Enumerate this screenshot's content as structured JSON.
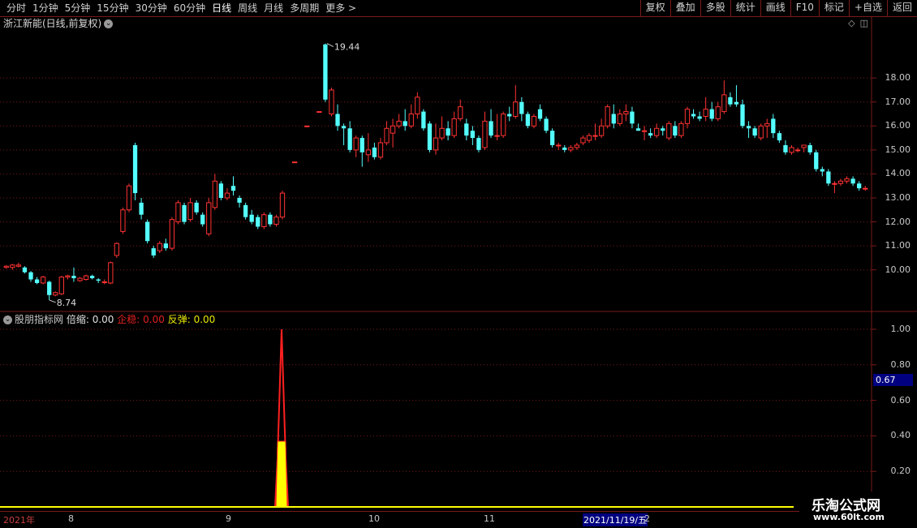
{
  "toolbar": {
    "tabs": [
      "分时",
      "1分钟",
      "5分钟",
      "15分钟",
      "30分钟",
      "60分钟",
      "日线",
      "周线",
      "月线",
      "多周期",
      "更多 >"
    ],
    "right_buttons": [
      "复权",
      "叠加",
      "多股",
      "统计",
      "画线",
      "F10",
      "标记",
      "+自选",
      "返回"
    ]
  },
  "stock": {
    "title": "浙江新能(日线,前复权)"
  },
  "indicator": {
    "name": "股朋指标网",
    "label1": "倍缩:",
    "value1": "0.00",
    "label2": "企稳:",
    "value2": "0.00",
    "label3": "反弹:",
    "value3": "0.00",
    "price_tag": "0.67"
  },
  "price_axis": [
    "18.00",
    "17.00",
    "16.00",
    "15.00",
    "14.00",
    "13.00",
    "12.00",
    "11.00",
    "10.00"
  ],
  "ind_axis": [
    "1.00",
    "0.80",
    "0.60",
    "0.40",
    "0.20"
  ],
  "annotations": {
    "high": "19.44",
    "low": "8.74"
  },
  "dates": {
    "year": "2021年",
    "m8": "8",
    "m9": "9",
    "m10": "10",
    "m11": "11",
    "selected": "2021/11/19/五",
    "m12": "2"
  },
  "watermark": {
    "line1": "乐淘公式网",
    "line2": "www.60lt.com"
  },
  "colors": {
    "up": "#ff3232",
    "down": "#54ffff",
    "grid": "#7a1a1a",
    "yellow": "#ffff00"
  },
  "chart_data": {
    "type": "candlestick",
    "candles": [
      [
        10.1,
        10.15,
        10.05,
        10.2
      ],
      [
        10.1,
        10.2,
        10.0,
        10.25
      ],
      [
        10.15,
        10.2,
        10.1,
        10.3
      ],
      [
        10.1,
        9.9,
        9.85,
        10.15
      ],
      [
        9.9,
        9.6,
        9.5,
        9.95
      ],
      [
        9.6,
        9.45,
        9.4,
        9.7
      ],
      [
        9.45,
        9.7,
        9.4,
        9.75
      ],
      [
        9.5,
        8.95,
        8.74,
        9.55
      ],
      [
        8.95,
        9.05,
        8.9,
        9.1
      ],
      [
        9.0,
        9.7,
        8.95,
        9.75
      ],
      [
        9.7,
        9.75,
        9.6,
        9.8
      ],
      [
        9.75,
        9.65,
        9.5,
        10.1
      ],
      [
        9.55,
        9.65,
        9.5,
        9.7
      ],
      [
        9.6,
        9.75,
        9.55,
        9.8
      ],
      [
        9.75,
        9.65,
        9.6,
        9.8
      ],
      [
        9.6,
        9.55,
        9.45,
        9.65
      ],
      [
        9.5,
        9.5,
        9.4,
        9.6
      ],
      [
        9.45,
        10.3,
        9.4,
        10.35
      ],
      [
        10.6,
        11.1,
        10.5,
        11.15
      ],
      [
        11.6,
        12.5,
        11.5,
        12.6
      ],
      [
        12.5,
        13.5,
        12.4,
        13.6
      ],
      [
        15.2,
        13.2,
        12.9,
        15.3
      ],
      [
        12.8,
        12.3,
        12.1,
        13.0
      ],
      [
        12.0,
        11.2,
        11.1,
        12.1
      ],
      [
        10.9,
        10.6,
        10.5,
        11.0
      ],
      [
        10.8,
        11.1,
        10.7,
        11.2
      ],
      [
        11.1,
        10.9,
        10.8,
        11.3
      ],
      [
        10.9,
        12.1,
        10.8,
        12.2
      ],
      [
        12.0,
        12.8,
        11.9,
        12.9
      ],
      [
        12.7,
        12.0,
        11.9,
        12.8
      ],
      [
        12.1,
        12.8,
        12.0,
        13.0
      ],
      [
        12.8,
        12.4,
        12.3,
        12.9
      ],
      [
        12.3,
        11.9,
        11.8,
        12.4
      ],
      [
        11.5,
        12.8,
        11.4,
        13.0
      ],
      [
        12.6,
        13.7,
        12.5,
        14.0
      ],
      [
        13.6,
        13.0,
        12.9,
        13.7
      ],
      [
        13.0,
        13.2,
        12.9,
        13.4
      ],
      [
        13.5,
        13.3,
        13.1,
        13.9
      ],
      [
        13.0,
        12.8,
        12.6,
        13.1
      ],
      [
        12.7,
        12.2,
        12.1,
        12.8
      ],
      [
        12.3,
        12.0,
        11.9,
        12.5
      ],
      [
        12.2,
        11.8,
        11.7,
        12.3
      ],
      [
        11.8,
        12.3,
        11.7,
        12.4
      ],
      [
        12.3,
        11.9,
        11.8,
        12.4
      ],
      [
        11.9,
        12.2,
        11.8,
        12.3
      ],
      [
        12.2,
        13.2,
        12.1,
        13.3
      ],
      [
        null,
        null,
        null,
        null
      ],
      [
        14.5,
        14.5,
        14.5,
        14.5
      ],
      [
        null,
        null,
        null,
        null
      ],
      [
        16.0,
        16.0,
        16.0,
        16.0
      ],
      [
        null,
        null,
        null,
        null
      ],
      [
        16.6,
        16.6,
        16.6,
        16.6
      ],
      [
        19.4,
        17.1,
        17.0,
        19.44
      ],
      [
        16.5,
        17.5,
        16.4,
        17.6
      ],
      [
        16.5,
        16.0,
        15.8,
        16.9
      ],
      [
        16.0,
        15.9,
        15.2,
        16.1
      ],
      [
        15.9,
        15.0,
        14.9,
        16.2
      ],
      [
        15.0,
        15.5,
        14.7,
        15.6
      ],
      [
        15.5,
        14.9,
        14.3,
        15.6
      ],
      [
        14.8,
        15.0,
        14.5,
        15.7
      ],
      [
        15.1,
        14.7,
        14.6,
        15.3
      ],
      [
        14.7,
        15.3,
        14.6,
        15.5
      ],
      [
        15.3,
        15.9,
        15.2,
        16.2
      ],
      [
        15.7,
        16.0,
        15.1,
        16.3
      ],
      [
        16.0,
        16.2,
        15.9,
        16.5
      ],
      [
        16.2,
        16.0,
        15.8,
        16.7
      ],
      [
        16.0,
        16.5,
        15.9,
        16.9
      ],
      [
        16.5,
        17.2,
        16.3,
        17.4
      ],
      [
        16.6,
        15.9,
        15.8,
        16.7
      ],
      [
        16.1,
        15.0,
        14.9,
        16.2
      ],
      [
        15.0,
        15.5,
        14.8,
        16.1
      ],
      [
        15.5,
        15.9,
        15.4,
        16.4
      ],
      [
        15.9,
        15.6,
        15.4,
        16.2
      ],
      [
        15.6,
        16.3,
        15.5,
        16.6
      ],
      [
        16.3,
        16.8,
        16.2,
        17.1
      ],
      [
        16.1,
        15.6,
        15.4,
        16.3
      ],
      [
        15.8,
        15.5,
        15.2,
        16.0
      ],
      [
        15.5,
        15.0,
        14.9,
        15.6
      ],
      [
        15.1,
        16.2,
        15.0,
        16.6
      ],
      [
        16.2,
        15.6,
        15.5,
        16.7
      ],
      [
        15.6,
        15.6,
        15.4,
        16.5
      ],
      [
        15.6,
        16.5,
        15.5,
        16.6
      ],
      [
        16.5,
        16.4,
        16.2,
        16.8
      ],
      [
        16.4,
        17.0,
        16.3,
        17.7
      ],
      [
        17.0,
        16.5,
        16.2,
        17.2
      ],
      [
        16.5,
        16.0,
        15.9,
        16.6
      ],
      [
        16.0,
        16.4,
        15.9,
        16.5
      ],
      [
        16.7,
        16.3,
        16.2,
        16.9
      ],
      [
        16.3,
        15.8,
        15.7,
        16.4
      ],
      [
        15.8,
        15.2,
        15.1,
        15.9
      ],
      [
        15.2,
        15.2,
        15.0,
        15.3
      ],
      [
        15.1,
        15.0,
        14.9,
        15.2
      ],
      [
        15.0,
        15.1,
        14.9,
        15.2
      ],
      [
        15.1,
        15.2,
        15.0,
        15.3
      ],
      [
        15.3,
        15.5,
        15.2,
        15.6
      ],
      [
        15.4,
        15.6,
        15.3,
        15.7
      ],
      [
        15.6,
        15.6,
        15.4,
        16.1
      ],
      [
        15.6,
        16.0,
        15.5,
        16.3
      ],
      [
        16.0,
        16.8,
        15.9,
        16.9
      ],
      [
        16.5,
        16.1,
        15.9,
        16.9
      ],
      [
        16.1,
        16.5,
        16.0,
        16.7
      ],
      [
        16.5,
        16.6,
        16.2,
        16.9
      ],
      [
        16.6,
        16.1,
        15.9,
        16.8
      ],
      [
        15.9,
        15.8,
        15.8,
        16.1
      ],
      [
        15.8,
        15.8,
        15.4,
        16.0
      ],
      [
        15.7,
        15.6,
        15.5,
        15.9
      ],
      [
        15.6,
        15.9,
        15.5,
        16.1
      ],
      [
        15.9,
        15.8,
        15.6,
        16.0
      ],
      [
        15.5,
        16.1,
        15.4,
        16.2
      ],
      [
        16.0,
        15.6,
        15.5,
        16.2
      ],
      [
        15.6,
        16.1,
        15.5,
        16.2
      ],
      [
        16.1,
        16.7,
        15.9,
        16.8
      ],
      [
        16.5,
        16.4,
        16.3,
        16.7
      ],
      [
        16.4,
        16.3,
        16.2,
        16.6
      ],
      [
        16.4,
        16.7,
        16.2,
        17.2
      ],
      [
        16.7,
        16.3,
        16.2,
        17.0
      ],
      [
        16.3,
        16.8,
        16.2,
        17.0
      ],
      [
        16.6,
        17.3,
        16.5,
        17.9
      ],
      [
        17.2,
        16.9,
        16.8,
        17.4
      ],
      [
        17.0,
        16.9,
        16.8,
        17.7
      ],
      [
        16.9,
        16.0,
        15.9,
        17.1
      ],
      [
        16.0,
        15.9,
        15.5,
        16.2
      ],
      [
        15.9,
        15.6,
        15.5,
        16.0
      ],
      [
        15.5,
        16.0,
        15.4,
        16.1
      ],
      [
        16.0,
        16.1,
        15.5,
        16.3
      ],
      [
        16.3,
        15.7,
        15.5,
        16.5
      ],
      [
        15.7,
        15.4,
        15.3,
        15.8
      ],
      [
        15.2,
        14.9,
        14.8,
        15.4
      ],
      [
        14.9,
        15.1,
        14.8,
        15.2
      ],
      [
        15.0,
        15.0,
        14.9,
        15.1
      ],
      [
        15.1,
        15.2,
        14.9,
        15.2
      ],
      [
        15.2,
        14.9,
        14.8,
        15.3
      ],
      [
        14.9,
        14.2,
        14.1,
        15.0
      ],
      [
        14.2,
        14.1,
        13.9,
        14.3
      ],
      [
        14.1,
        13.6,
        13.5,
        14.2
      ],
      [
        13.6,
        13.6,
        13.2,
        13.7
      ],
      [
        13.6,
        13.7,
        13.5,
        13.8
      ],
      [
        13.7,
        13.8,
        13.6,
        13.9
      ],
      [
        13.8,
        13.6,
        13.5,
        13.9
      ],
      [
        13.6,
        13.4,
        13.3,
        13.7
      ],
      [
        13.4,
        13.4,
        13.3,
        13.5
      ]
    ],
    "indicator_spike": {
      "red": 1.0,
      "yellow": 0.37
    },
    "price_range": [
      8.4,
      19.9
    ],
    "ind_range": [
      0,
      1.05
    ]
  }
}
